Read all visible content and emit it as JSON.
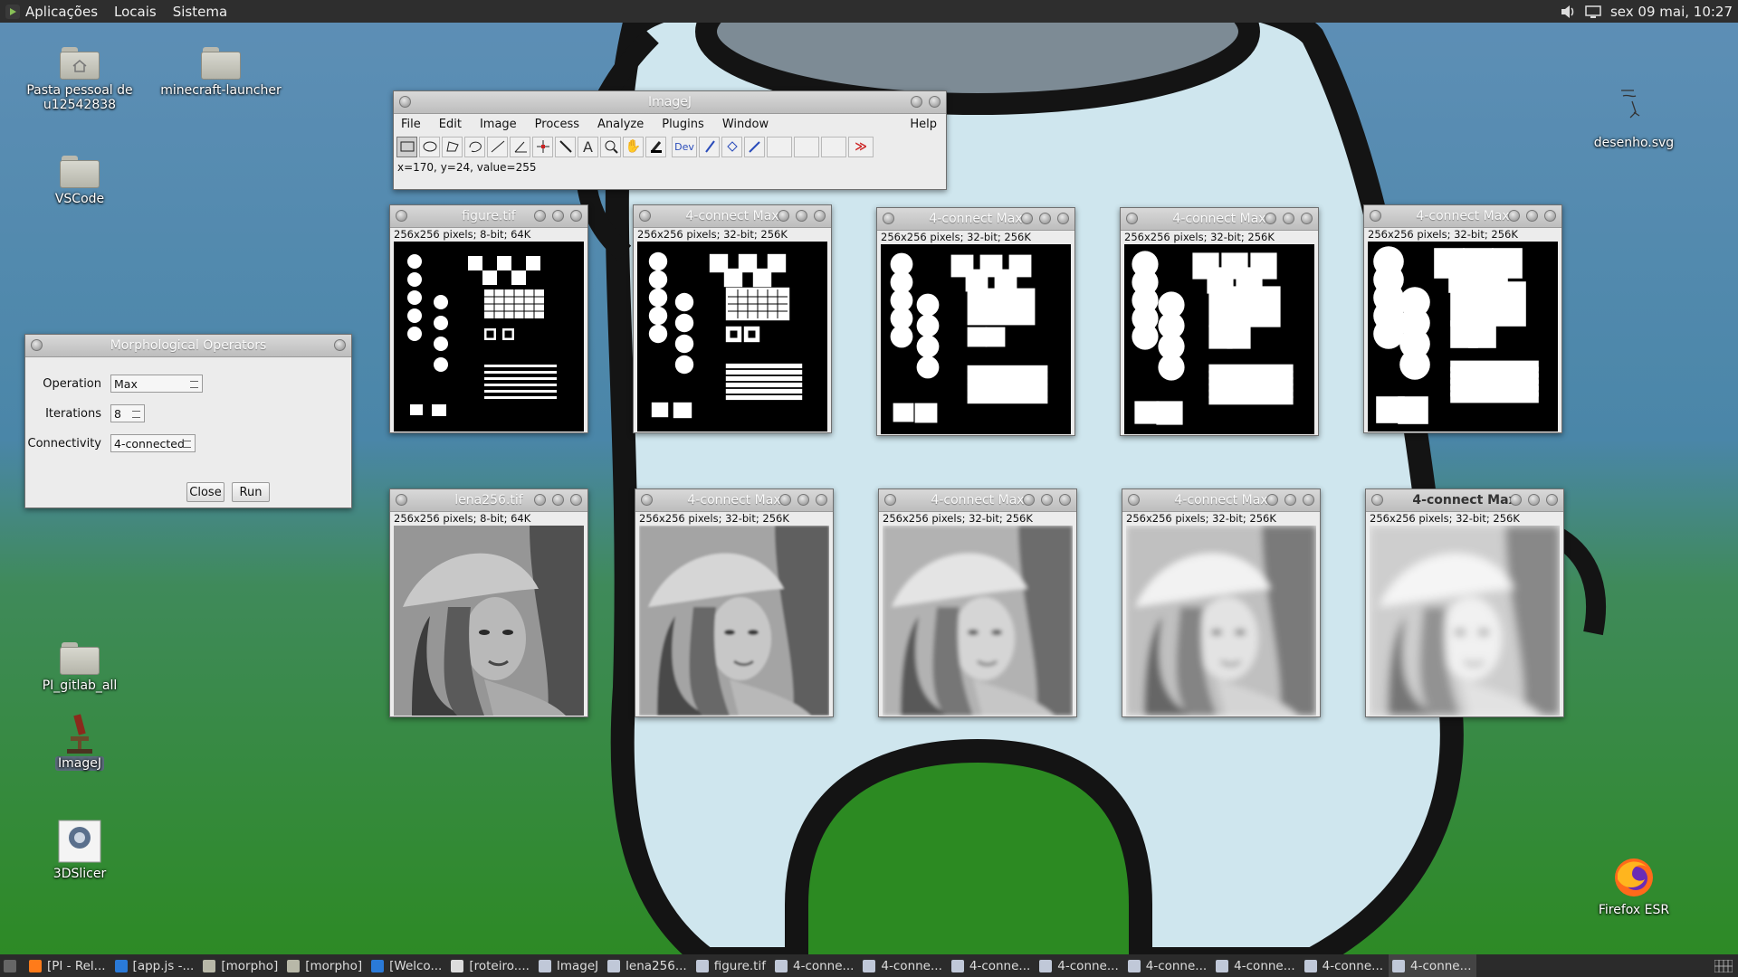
{
  "top_panel": {
    "menus": [
      "Aplicações",
      "Locais",
      "Sistema"
    ],
    "clock": "sex 09 mai, 10:27"
  },
  "desktop_icons": [
    {
      "label": "Pasta pessoal de u12542838",
      "icon": "home-folder-icon"
    },
    {
      "label": "minecraft-launcher",
      "icon": "folder-icon"
    },
    {
      "label": "VSCode",
      "icon": "folder-icon"
    },
    {
      "label": "PI_gitlab_all",
      "icon": "folder-icon"
    },
    {
      "label": "ImageJ",
      "icon": "microscope-icon"
    },
    {
      "label": "3DSlicer",
      "icon": "slicer-icon"
    },
    {
      "label": "desenho.svg",
      "icon": "svg-file-icon"
    },
    {
      "label": "Firefox ESR",
      "icon": "firefox-icon"
    }
  ],
  "imagej": {
    "title": "ImageJ",
    "menus": [
      "File",
      "Edit",
      "Image",
      "Process",
      "Analyze",
      "Plugins",
      "Window",
      "Help"
    ],
    "tools": [
      "rectangle-tool-icon",
      "oval-tool-icon",
      "polygon-tool-icon",
      "freehand-tool-icon",
      "line-tool-icon",
      "angle-tool-icon",
      "point-tool-icon",
      "wand-tool-icon",
      "text-tool-icon",
      "magnifier-icon",
      "hand-icon",
      "color-picker-icon",
      "dev-menu-icon",
      "paintbrush-icon",
      "flood-fill-icon",
      "pipette-icon",
      "empty-slot",
      "empty-slot",
      "empty-slot",
      "more-tools-icon"
    ],
    "dev_label": "Dev",
    "status": "x=170, y=24, value=255"
  },
  "image_windows": [
    {
      "title": "figure.tif",
      "info": "256x256 pixels; 8-bit; 64K",
      "kind": "figure",
      "dilation": 0
    },
    {
      "title": "4-connect Max",
      "info": "256x256 pixels; 32-bit; 256K",
      "kind": "figure",
      "dilation": 1
    },
    {
      "title": "4-connect Max",
      "info": "256x256 pixels; 32-bit; 256K",
      "kind": "figure",
      "dilation": 2
    },
    {
      "title": "4-connect Max",
      "info": "256x256 pixels; 32-bit; 256K",
      "kind": "figure",
      "dilation": 3
    },
    {
      "title": "4-connect Max",
      "info": "256x256 pixels; 32-bit; 256K",
      "kind": "figure",
      "dilation": 4
    },
    {
      "title": "lena256.tif",
      "info": "256x256 pixels; 8-bit; 64K",
      "kind": "photo",
      "blur": 0
    },
    {
      "title": "4-connect Max",
      "info": "256x256 pixels; 32-bit; 256K",
      "kind": "photo",
      "blur": 1
    },
    {
      "title": "4-connect Max",
      "info": "256x256 pixels; 32-bit; 256K",
      "kind": "photo",
      "blur": 2
    },
    {
      "title": "4-connect Max",
      "info": "256x256 pixels; 32-bit; 256K",
      "kind": "photo",
      "blur": 3
    },
    {
      "title": "4-connect Max",
      "info": "256x256 pixels; 32-bit; 256K",
      "kind": "photo",
      "blur": 4,
      "active": true
    }
  ],
  "dialog": {
    "title": "Morphological Operators",
    "operation_label": "Operation",
    "operation_value": "Max",
    "iterations_label": "Iterations",
    "iterations_value": "8",
    "connectivity_label": "Connectivity",
    "connectivity_value": "4-connected",
    "close_label": "Close",
    "run_label": "Run"
  },
  "taskbar": [
    {
      "label": "[PI - Rel...",
      "icon": "firefox-icon"
    },
    {
      "label": "[app.js -...",
      "icon": "vscode-icon"
    },
    {
      "label": "[morpho]",
      "icon": "folder-icon"
    },
    {
      "label": "[morpho]",
      "icon": "folder-icon"
    },
    {
      "label": "[Welco...",
      "icon": "vscode-icon"
    },
    {
      "label": "[roteiro....",
      "icon": "document-icon"
    },
    {
      "label": "ImageJ",
      "icon": "imagej-icon"
    },
    {
      "label": "lena256...",
      "icon": "imagej-icon"
    },
    {
      "label": "figure.tif",
      "icon": "imagej-icon"
    },
    {
      "label": "4-conne...",
      "icon": "imagej-icon"
    },
    {
      "label": "4-conne...",
      "icon": "imagej-icon"
    },
    {
      "label": "4-conne...",
      "icon": "imagej-icon"
    },
    {
      "label": "4-conne...",
      "icon": "imagej-icon"
    },
    {
      "label": "4-conne...",
      "icon": "imagej-icon"
    },
    {
      "label": "4-conne...",
      "icon": "imagej-icon"
    },
    {
      "label": "4-conne...",
      "icon": "imagej-icon"
    },
    {
      "label": "4-conne...",
      "icon": "imagej-icon",
      "active": true
    }
  ],
  "colors": {
    "sky": "#4f86b0",
    "grass": "#2f8a2a",
    "character": "#cfe6ee",
    "outline": "#141414"
  }
}
